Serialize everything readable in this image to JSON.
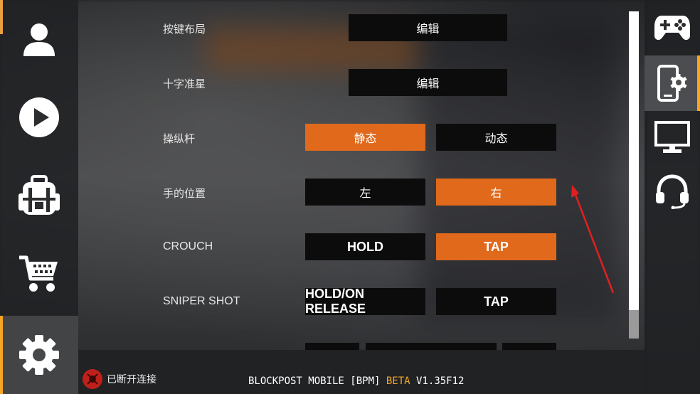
{
  "settings": {
    "rows": [
      {
        "label": "按键布局",
        "buttons": [
          {
            "label": "编辑"
          }
        ]
      },
      {
        "label": "十字准星",
        "buttons": [
          {
            "label": "编辑"
          }
        ]
      },
      {
        "label": "操纵杆",
        "buttons": [
          {
            "label": "静态",
            "selected": true
          },
          {
            "label": "动态",
            "selected": false
          }
        ]
      },
      {
        "label": "手的位置",
        "buttons": [
          {
            "label": "左",
            "selected": false
          },
          {
            "label": "右",
            "selected": true
          }
        ]
      },
      {
        "label": "CROUCH",
        "buttons": [
          {
            "label": "HOLD",
            "selected": false
          },
          {
            "label": "TAP",
            "selected": true
          }
        ]
      },
      {
        "label": "SNIPER SHOT",
        "buttons": [
          {
            "label": "HOLD/ON RELEASE",
            "selected": false
          },
          {
            "label": "TAP",
            "selected": false
          }
        ]
      }
    ]
  },
  "left_nav": [
    "profile-icon",
    "play-icon",
    "backpack-icon",
    "shop-cart-icon",
    "settings-gear-icon"
  ],
  "right_nav": [
    "gamepad-icon",
    "phone-settings-icon",
    "monitor-icon",
    "headset-icon"
  ],
  "status": {
    "label": "已断开连接"
  },
  "footer": {
    "app_name": "BLOCKPOST MOBILE [BPM]",
    "beta": "BETA",
    "version": "V1.35F12"
  },
  "colors": {
    "selected": "#e0691c",
    "unselected": "#0c0c0c",
    "beta": "#f5a623",
    "annotation_arrow": "#e02020"
  }
}
